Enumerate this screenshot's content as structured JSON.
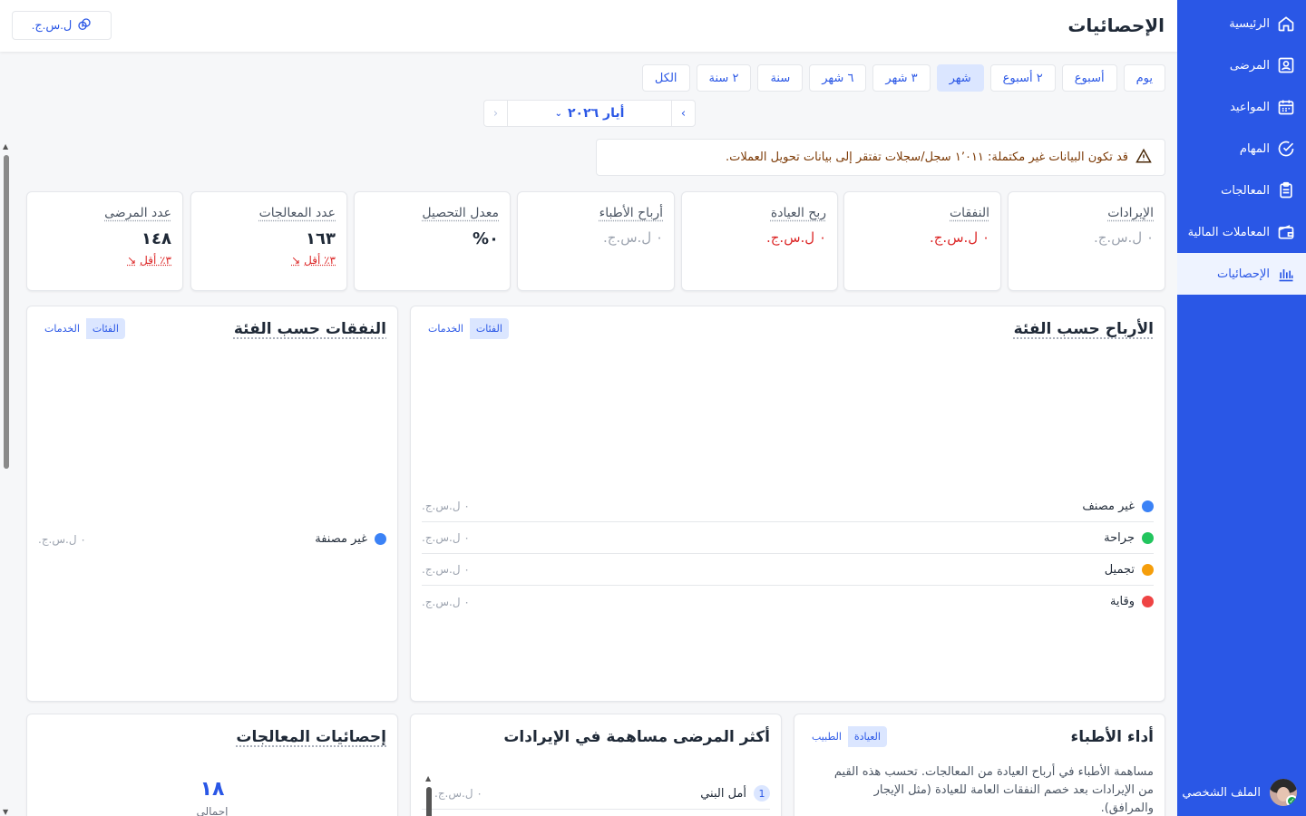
{
  "page_title": "الإحصائيات",
  "currency_button": "ل.س.ج.",
  "sidebar": {
    "items": [
      {
        "label": "الرئيسية",
        "icon": "home-icon"
      },
      {
        "label": "المرضى",
        "icon": "patient-id-icon"
      },
      {
        "label": "المواعيد",
        "icon": "calendar-icon"
      },
      {
        "label": "المهام",
        "icon": "check-circle-icon"
      },
      {
        "label": "المعالجات",
        "icon": "clipboard-icon"
      },
      {
        "label": "المعاملات المالية",
        "icon": "wallet-icon"
      },
      {
        "label": "الإحصائيات",
        "icon": "chart-icon",
        "active": true
      }
    ],
    "profile_label": "الملف الشخصي"
  },
  "periods": [
    "يوم",
    "أسبوع",
    "٢ أسبوع",
    "شهر",
    "٣ شهر",
    "٦ شهر",
    "سنة",
    "٢ سنة",
    "الكل"
  ],
  "active_period": "شهر",
  "date_nav": {
    "label": "أيار ٢٠٢٦"
  },
  "warning": "قد تكون البيانات غير مكتملة: ١٬٠١١ سجل/سجلات تفتقر إلى بيانات تحويل العملات.",
  "kpis": [
    {
      "title": "الإيرادات",
      "value": "٠ ل.س.ج.",
      "style": "gray"
    },
    {
      "title": "النفقات",
      "value": "٠ ل.س.ج.",
      "style": "red"
    },
    {
      "title": "ربح العيادة",
      "value": "٠ ل.س.ج.",
      "style": "red"
    },
    {
      "title": "أرباح الأطباء",
      "value": "٠ ل.س.ج.",
      "style": "gray"
    },
    {
      "title": "معدل التحصيل",
      "value": "٠%",
      "style": "big"
    },
    {
      "title": "عدد المعالجات",
      "value": "١٦٣",
      "style": "big",
      "change": "٣٪ أقل"
    },
    {
      "title": "عدد المرضى",
      "value": "١٤٨",
      "style": "big",
      "change": "٣٪ أقل"
    }
  ],
  "profit_by_category": {
    "title": "الأرباح حسب الفئة",
    "toggle": [
      "الفئات",
      "الخدمات"
    ],
    "rows": [
      {
        "name": "غير مصنف",
        "color": "#3b82f6",
        "amount": "٠ ل.س.ج."
      },
      {
        "name": "جراحة",
        "color": "#22c55e",
        "amount": "٠ ل.س.ج."
      },
      {
        "name": "تجميل",
        "color": "#f59e0b",
        "amount": "٠ ل.س.ج."
      },
      {
        "name": "وقاية",
        "color": "#ef4444",
        "amount": "٠ ل.س.ج."
      }
    ]
  },
  "expenses_by_category": {
    "title": "النفقات حسب الفئة",
    "toggle": [
      "الفئات",
      "الخدمات"
    ],
    "rows": [
      {
        "name": "غير مصنفة",
        "color": "#3b82f6",
        "amount": "٠ ل.س.ج."
      }
    ]
  },
  "doctor_performance": {
    "title": "أداء الأطباء",
    "toggle": [
      "العيادة",
      "الطبيب"
    ],
    "description": "مساهمة الأطباء في أرباح العيادة من المعالجات. تحسب هذه القيم من الإيرادات بعد خصم النفقات العامة للعيادة (مثل الإيجار والمرافق)."
  },
  "top_patients": {
    "title": "أكثر المرضى مساهمة في الإيرادات",
    "rows": [
      {
        "rank": "1",
        "name": "أمل البني",
        "amount": "٠ ل.س.ج."
      }
    ]
  },
  "treatment_stats": {
    "title": "إحصائيات المعالجات",
    "total_value": "١٨",
    "total_label": "إجمالي"
  }
}
